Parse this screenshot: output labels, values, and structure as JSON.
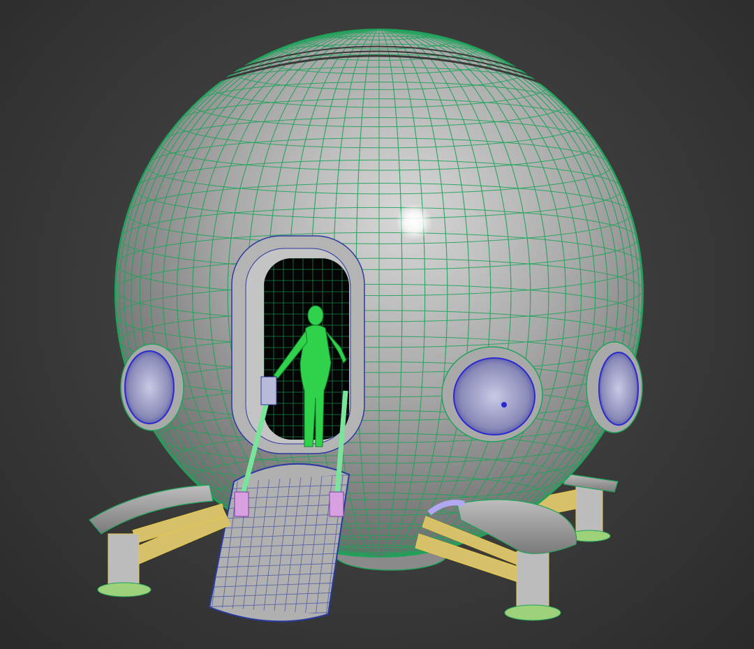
{
  "scene": {
    "colors": {
      "background": "#3c3c3c",
      "sphere_shading": "#9c9c9c",
      "wireframe": "#1fa35a",
      "porthole_glass": "#2a2ad0",
      "human_figure": "#2fd24a",
      "strut_wireframe": "#e6c84a",
      "highlight": "#ffffff"
    },
    "objects": [
      "spherical-pod",
      "entry-door",
      "human-figure",
      "boarding-ramp",
      "portholes",
      "landing-legs"
    ]
  }
}
